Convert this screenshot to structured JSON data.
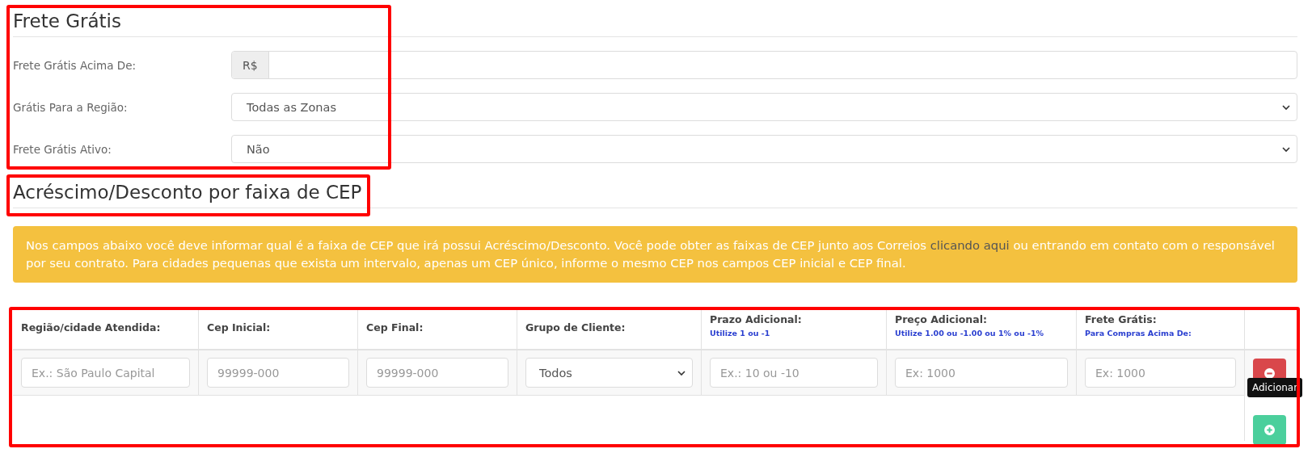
{
  "free_shipping": {
    "title": "Frete Grátis",
    "fields": [
      {
        "label": "Frete Grátis Acima De:",
        "kind": "money",
        "prefix": "R$"
      },
      {
        "label": "Grátis Para a Região:",
        "kind": "select",
        "value": "Todas as Zonas"
      },
      {
        "label": "Frete Grátis Ativo:",
        "kind": "select",
        "value": "Não"
      }
    ]
  },
  "cep_ranges": {
    "title": "Acréscimo/Desconto por faixa de CEP",
    "alert": {
      "text_before": "Nos campos abaixo você deve informar qual é a faixa de CEP que irá possui Acréscimo/Desconto. Você pode obter as faixas de CEP junto aos Correios",
      "link": "clicando aqui",
      "text_after": "ou entrando em contato com o responsável por seu contrato. Para cidades pequenas que exista um intervalo, apenas um CEP único, informe o mesmo CEP nos campos CEP inicial e CEP final."
    },
    "table": {
      "columns": [
        {
          "label": "Região/cidade Atendida:"
        },
        {
          "label": "Cep Inicial:"
        },
        {
          "label": "Cep Final:"
        },
        {
          "label": "Grupo de Cliente:"
        },
        {
          "label": "Prazo Adicional:",
          "hint": "Utilize 1 ou -1"
        },
        {
          "label": "Preço Adicional:",
          "hint": "Utilize 1.00 ou -1.00 ou 1% ou -1%"
        },
        {
          "label": "Frete Grátis:",
          "hint": "Para Compras Acima De:"
        }
      ],
      "rows": [
        {
          "cells": [
            {
              "kind": "input",
              "placeholder": "Ex.: São Paulo Capital"
            },
            {
              "kind": "input",
              "placeholder": "99999-000"
            },
            {
              "kind": "input",
              "placeholder": "99999-000"
            },
            {
              "kind": "select",
              "value": "Todos"
            },
            {
              "kind": "input",
              "placeholder": "Ex.: 10 ou -10"
            },
            {
              "kind": "input",
              "placeholder": "Ex: 1000"
            },
            {
              "kind": "input",
              "placeholder": "Ex: 1000"
            }
          ]
        }
      ],
      "add_tooltip": "Adicionar"
    }
  }
}
